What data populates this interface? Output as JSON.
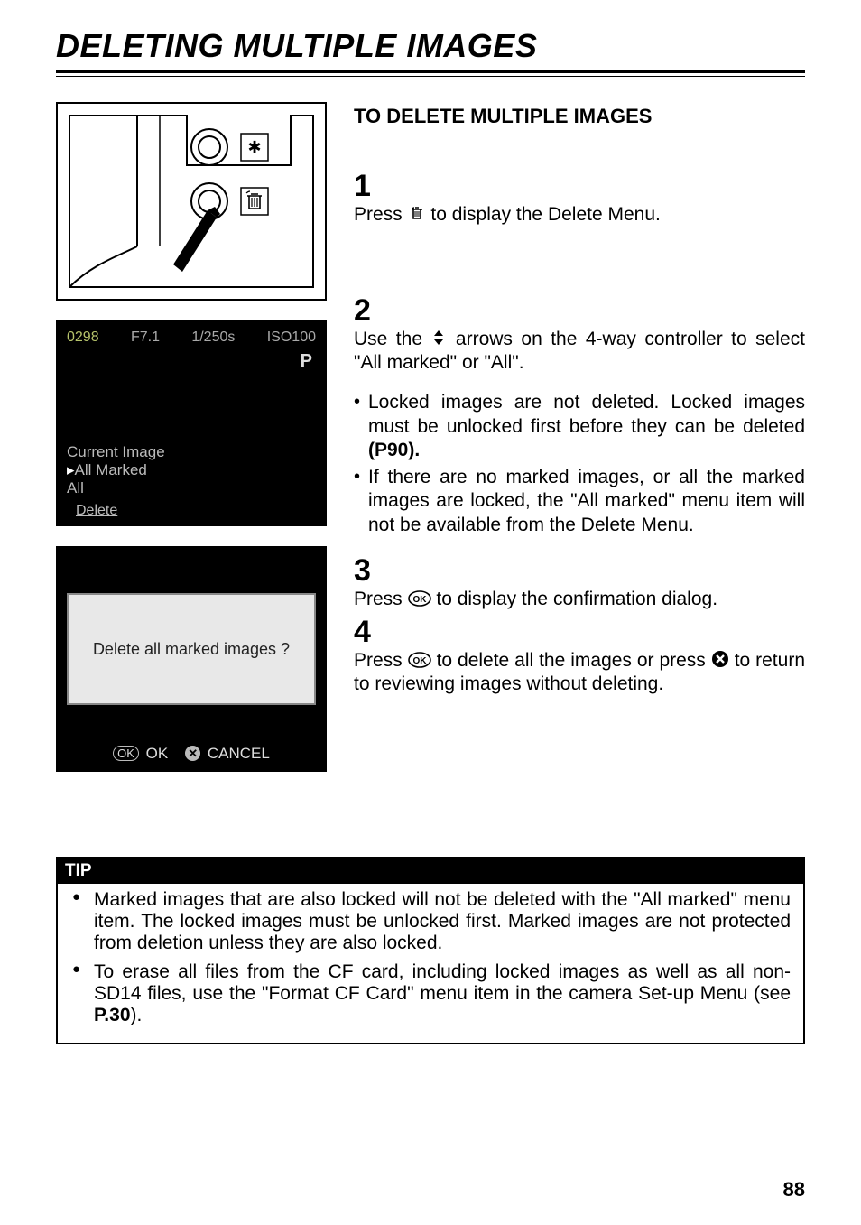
{
  "page": {
    "title": "DELETING MULTIPLE IMAGES",
    "number": "88"
  },
  "subheading": "TO DELETE MULTIPLE IMAGES",
  "steps": {
    "s1": {
      "num": "1",
      "text_a": "Press ",
      "text_b": " to display the Delete Menu."
    },
    "s2": {
      "num": "2",
      "text_a": "Use the ",
      "text_b": " arrows on the 4-way controller to select \"All marked\" or \"All\"."
    },
    "s3": {
      "num": "3",
      "text_a": "Press ",
      "text_b": " to display the confirmation dialog."
    },
    "s4": {
      "num": "4",
      "text_a": "Press ",
      "text_b": " to delete all the images or press ",
      "text_c": " to return to reviewing images without deleting."
    }
  },
  "bullets_after_step2": [
    {
      "a": "Locked images are not deleted.  Locked images must be unlocked first before they can be deleted ",
      "b": "(P90)."
    },
    {
      "a": "If there are no marked images, or all the marked images are locked, the \"All marked\" menu item will not be available from the Delete Menu."
    }
  ],
  "lcd1": {
    "counter": "0298",
    "aperture": "F7.1",
    "shutter": "1/250s",
    "iso": "ISO100",
    "flag": "P",
    "menu": [
      "Current Image",
      "All Marked",
      "All"
    ],
    "bottom": "Delete"
  },
  "lcd2": {
    "prompt": "Delete all marked images ?",
    "ok_label": "OK",
    "cancel_label": "CANCEL"
  },
  "tip": {
    "heading": "TIP",
    "items": [
      {
        "a": " Marked images that are also locked will not be deleted with the \"All marked\" menu item.  The locked images must be unlocked first.  Marked images are not protected from deletion unless they are also locked."
      },
      {
        "a": " To erase all files from the CF card, including locked images as well as all non-SD14 files, use the \"Format CF Card\" menu item in the camera Set-up Menu (see ",
        "b": "P.30",
        "c": ")."
      }
    ]
  }
}
